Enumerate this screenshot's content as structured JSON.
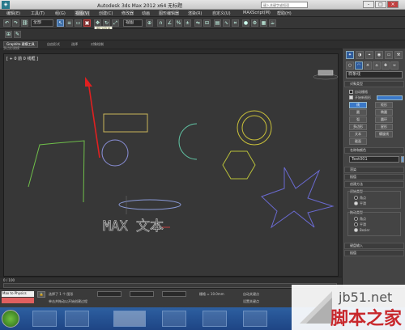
{
  "titlebar": {
    "title": "Autodesk 3ds Max  2012 x64      无标题",
    "search_placeholder": "键入关键字或短语",
    "minimize": "-",
    "maximize": "□",
    "close": "×"
  },
  "menu": [
    "编辑(E)",
    "工具(T)",
    "组(G)",
    "视图(V)",
    "创建(C)",
    "修改器",
    "动画",
    "图形编辑器",
    "渲染(R)",
    "自定义(U)",
    "MAXScript(M)",
    "帮助(H)"
  ],
  "toolbar": {
    "selection_filter": "全部",
    "coord_system": "视图",
    "tooltip": "窗口/交叉"
  },
  "ribbon": {
    "tabs": [
      "Graphite 建模工具",
      "自由形式",
      "选择",
      "对象绘制"
    ],
    "sub": "多边形建模"
  },
  "viewport": {
    "label": "[ + 0 前 0 线框 ]",
    "text_object": "MAX 文本"
  },
  "cmdpanel": {
    "category": "样条线",
    "rollout_object_type": "对象类型",
    "autogrid": "自动栅格",
    "start_new_shape": "开始新图形",
    "buttons": [
      [
        "线",
        "矩形"
      ],
      [
        "圆",
        "椭圆"
      ],
      [
        "弧",
        "圆环"
      ],
      [
        "多边形",
        "星形"
      ],
      [
        "文本",
        "螺旋线"
      ],
      [
        "截面",
        ""
      ]
    ],
    "rollout_name_color": "名称和颜色",
    "object_name": "Text001",
    "rollout_render": "渲染",
    "rollout_interp": "插值",
    "rollout_create_method": "创建方法",
    "initial_type": "初始类型",
    "initial_opts": [
      "角点",
      "平滑"
    ],
    "drag_type": "拖动类型",
    "drag_opts": [
      "角点",
      "平滑",
      "Bezier"
    ],
    "rollout_keyboard": "键盘输入",
    "rollout_interp2": "插值"
  },
  "timeline": {
    "frame": "0 / 100"
  },
  "status": {
    "maxscript": "Max to Physics",
    "selected": "选择了 1 个 图形",
    "prompt": "单击并拖动以开始创建过程",
    "grid": "栅格 = 10.0mm",
    "autokey": "自动关键点",
    "setkey": "设置关键点"
  },
  "watermark": {
    "url": "jb51.net",
    "site": "脚本之家"
  },
  "colors": {
    "line_green": "#6fbf4a",
    "rect_yellow": "#c9b45a",
    "circle_blue": "#8a8fd8",
    "arc_green": "#5fbfa0",
    "donut_yellow": "#c9c03a",
    "ngon_yellow": "#b9c03a",
    "star_blue": "#6a6ad0",
    "ellipse_blue": "#8a9ad8",
    "text_gray": "#cfcfcf"
  }
}
